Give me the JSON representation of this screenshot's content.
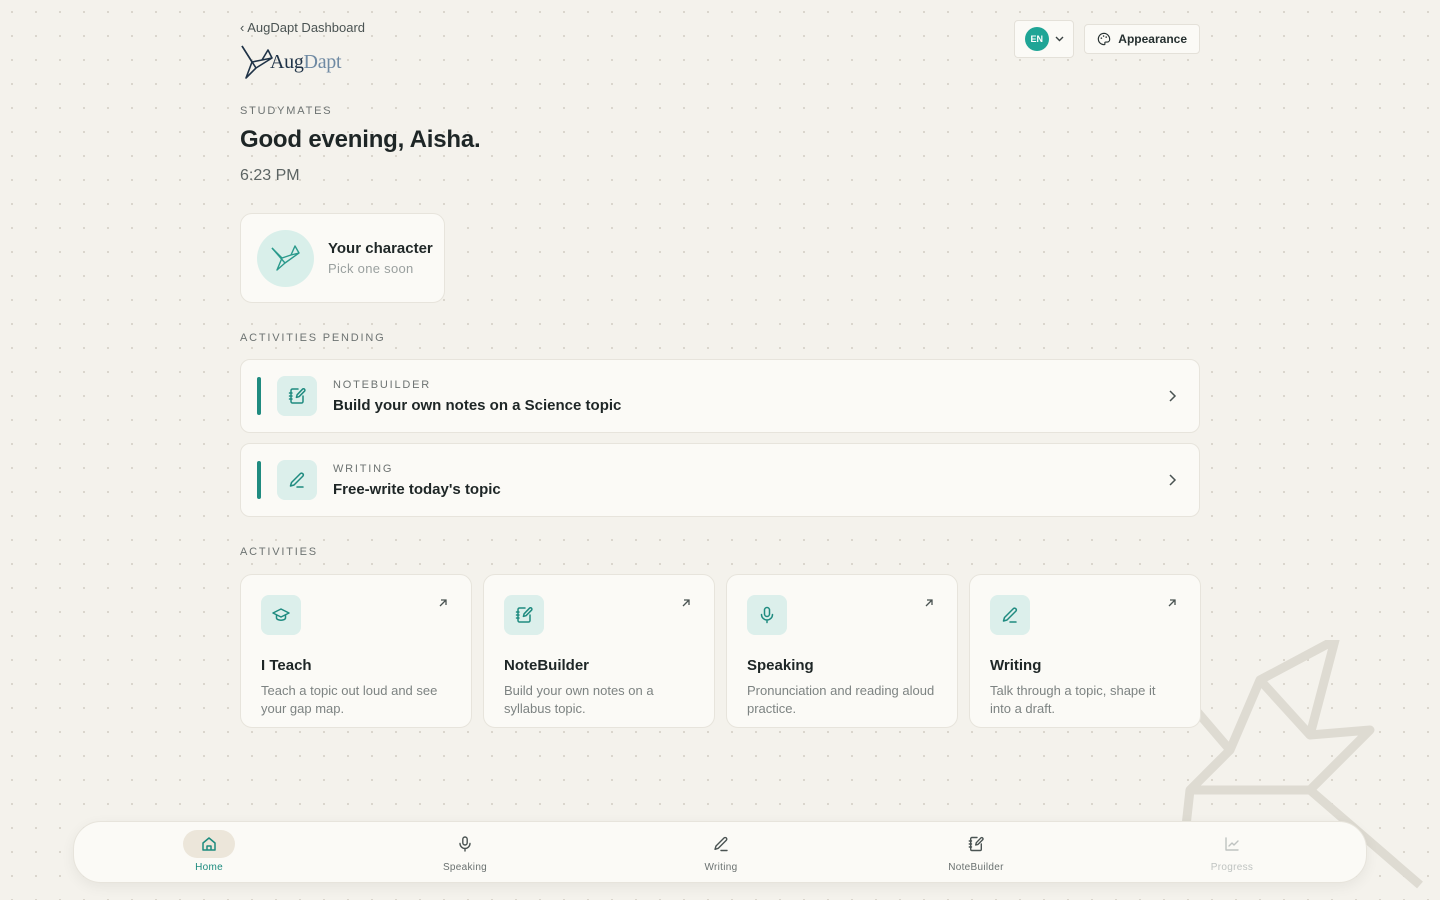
{
  "header": {
    "back_link": "‹ AugDapt Dashboard",
    "logo": {
      "aug": "Aug",
      "dapt": "Dapt"
    },
    "language": {
      "code": "EN"
    },
    "appearance_label": "Appearance"
  },
  "hero": {
    "kicker": "STUDYMATES",
    "greeting": "Good evening, Aisha.",
    "time": "6:23 PM"
  },
  "character": {
    "title": "Your character",
    "subtitle": "Pick one soon",
    "icon": "crane-icon"
  },
  "pending": {
    "label": "ACTIVITIES PENDING",
    "items": [
      {
        "kicker": "NOTEBUILDER",
        "title": "Build your own notes on a Science topic",
        "icon": "notebook-pen-icon"
      },
      {
        "kicker": "WRITING",
        "title": "Free-write today's topic",
        "icon": "pen-icon"
      }
    ]
  },
  "activities": {
    "label": "ACTIVITIES",
    "items": [
      {
        "title": "I Teach",
        "desc": "Teach a topic out loud and see your gap map.",
        "icon": "graduation-cap-icon"
      },
      {
        "title": "NoteBuilder",
        "desc": "Build your own notes on a syllabus topic.",
        "icon": "notebook-pen-icon"
      },
      {
        "title": "Speaking",
        "desc": "Pronunciation and reading aloud practice.",
        "icon": "microphone-icon"
      },
      {
        "title": "Writing",
        "desc": "Talk through a topic, shape it into a draft.",
        "icon": "pen-icon"
      }
    ]
  },
  "nav": {
    "items": [
      {
        "label": "Home",
        "icon": "home-icon",
        "state": "active"
      },
      {
        "label": "Speaking",
        "icon": "microphone-icon",
        "state": "default"
      },
      {
        "label": "Writing",
        "icon": "pen-icon",
        "state": "default"
      },
      {
        "label": "NoteBuilder",
        "icon": "notebook-pen-icon",
        "state": "default"
      },
      {
        "label": "Progress",
        "icon": "chart-icon",
        "state": "disabled"
      }
    ]
  },
  "colors": {
    "accent": "#1f8b80",
    "accent_tint": "#dcefeb",
    "background": "#f4f2ec",
    "card": "#fbfaf6"
  }
}
